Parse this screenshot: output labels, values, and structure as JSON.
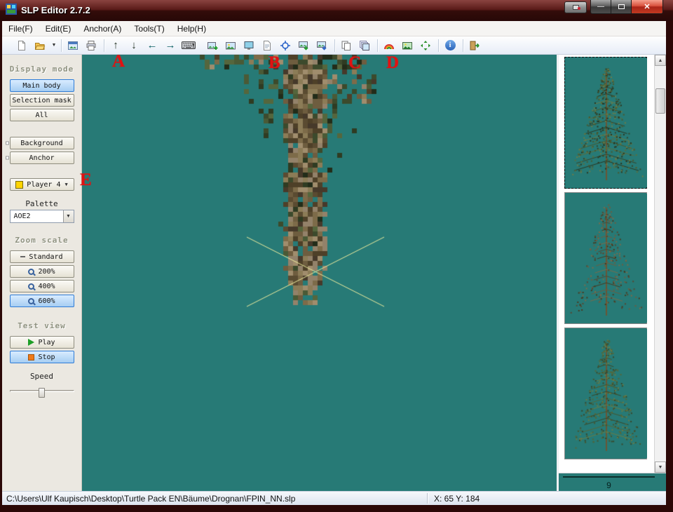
{
  "window": {
    "title": "SLP Editor 2.7.2"
  },
  "menu": {
    "items": [
      {
        "label": "File(F)"
      },
      {
        "label": "Edit(E)"
      },
      {
        "label": "Anchor(A)"
      },
      {
        "label": "Tools(T)"
      },
      {
        "label": "Help(H)"
      }
    ]
  },
  "annotations": {
    "a": "A",
    "b": "B",
    "c": "C",
    "d": "D",
    "e": "E"
  },
  "sidebar": {
    "display_mode": {
      "label": "Display mode",
      "main_body": "Main body",
      "selection_mask": "Selection mask",
      "all": "All"
    },
    "layers": {
      "background": "Background",
      "anchor": "Anchor"
    },
    "player": {
      "value": "Player 4",
      "swatch_color": "#ffd400"
    },
    "palette": {
      "label": "Palette",
      "value": "AOE2"
    },
    "zoom": {
      "label": "Zoom scale",
      "standard": "Standard",
      "z200": "200%",
      "z400": "400%",
      "z600": "600%"
    },
    "test_view": {
      "label": "Test view",
      "play": "Play",
      "stop": "Stop",
      "speed": "Speed"
    }
  },
  "canvas": {
    "background_color": "#277a76",
    "cross_color": "#ecec9e"
  },
  "panel": {
    "frame_number": "9"
  },
  "statusbar": {
    "path": "C:\\Users\\Ulf Kaupisch\\Desktop\\Turtle Pack EN\\Bäume\\Drognan\\FPIN_NN.slp",
    "coords": "X: 65 Y: 184"
  }
}
